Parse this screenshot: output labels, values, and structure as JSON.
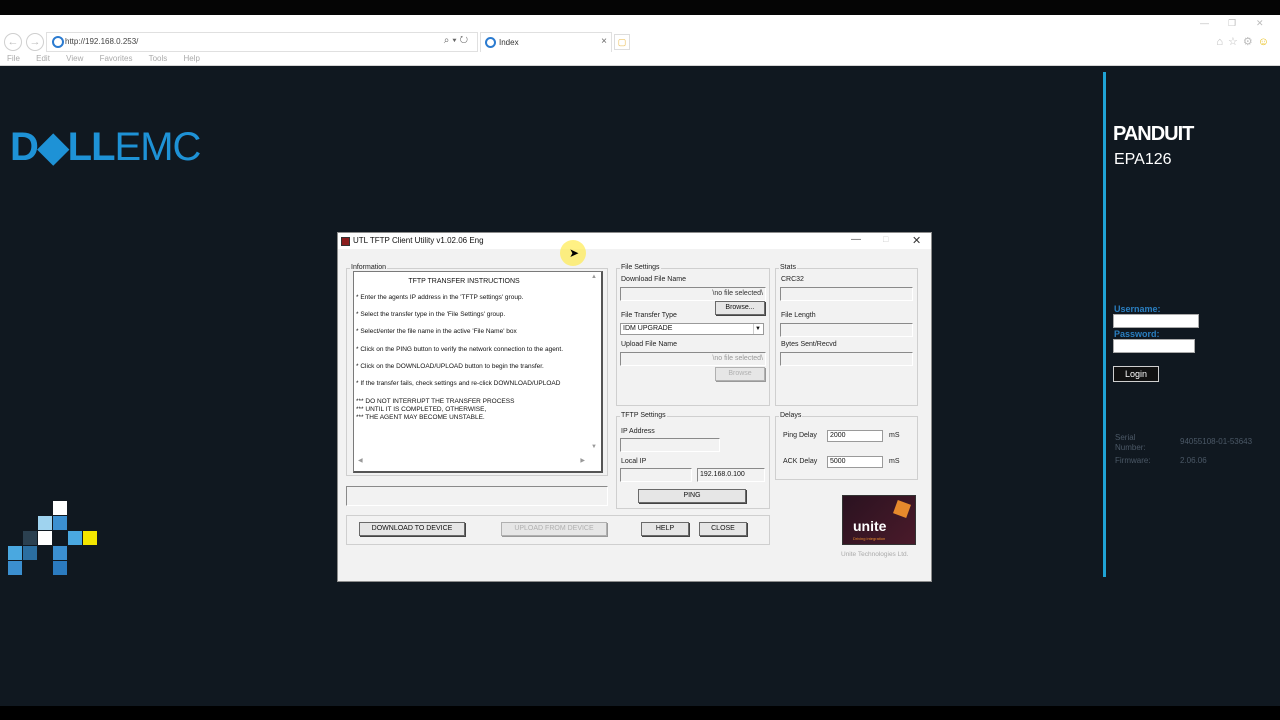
{
  "browser": {
    "url": "http://192.168.0.253/",
    "tab_title": "Index",
    "menu": [
      "File",
      "Edit",
      "View",
      "Favorites",
      "Tools",
      "Help"
    ]
  },
  "page": {
    "brand_left": {
      "dell": "D◆LL",
      "emc": "EMC"
    },
    "brand_right": "PANDUIT",
    "model": "EPA126",
    "login": {
      "username_label": "Username:",
      "password_label": "Password:",
      "button_label": "Login"
    },
    "info": {
      "serial_label_1": "Serial",
      "serial_label_2": "Number:",
      "serial_value": "94055108-01-53643",
      "firmware_label": "Firmware:",
      "firmware_value": "2.06.06"
    },
    "colors": {
      "accent": "#1fa3d5",
      "dell_blue": "#1e92d6",
      "background": "#101820"
    }
  },
  "dialog": {
    "title": "UTL TFTP Client Utility v1.02.06 Eng",
    "information": {
      "group_label": "Information",
      "heading": "TFTP TRANSFER INSTRUCTIONS",
      "lines": [
        "* Enter the agents IP address in the 'TFTP settings' group.",
        "* Select the transfer type in the 'File Settings' group.",
        "* Select/enter the file name in the active 'File Name' box",
        "* Click on the PING button to verify the network connection to the agent.",
        "* Click on the DOWNLOAD/UPLOAD button to begin the transfer.",
        "* If the transfer fails, check settings and re-click DOWNLOAD/UPLOAD"
      ],
      "warnings": [
        "*** DO NOT INTERRUPT THE TRANSFER PROCESS",
        "*** UNTIL IT IS COMPLETED, OTHERWISE,",
        "*** THE AGENT MAY BECOME UNSTABLE."
      ]
    },
    "file_settings": {
      "group_label": "File Settings",
      "download_label": "Download File Name",
      "download_value": "\\no file selected\\",
      "browse_label": "Browse...",
      "type_label": "File Transfer Type",
      "type_value": "IDM UPGRADE",
      "upload_label": "Upload File Name",
      "upload_value": "\\no file selected\\",
      "browse2_label": "Browse"
    },
    "stats": {
      "group_label": "Stats",
      "crc_label": "CRC32",
      "length_label": "File Length",
      "bytes_label": "Bytes Sent/Recvd"
    },
    "tftp": {
      "group_label": "TFTP Settings",
      "ip_label": "IP Address",
      "local_label": "Local IP",
      "local_value": "192.168.0.100",
      "ping_label": "PING"
    },
    "delays": {
      "group_label": "Delays",
      "ping_label": "Ping Delay",
      "ping_value": "2000",
      "ping_unit": "mS",
      "ack_label": "ACK Delay",
      "ack_value": "5000",
      "ack_unit": "mS"
    },
    "buttons": {
      "download": "DOWNLOAD TO DEVICE",
      "upload": "UPLOAD FROM DEVICE",
      "help": "HELP",
      "close": "CLOSE"
    },
    "unite": {
      "logo_text": "unite",
      "tagline": "Driving integration",
      "caption": "Unite Technologies Ltd."
    }
  }
}
